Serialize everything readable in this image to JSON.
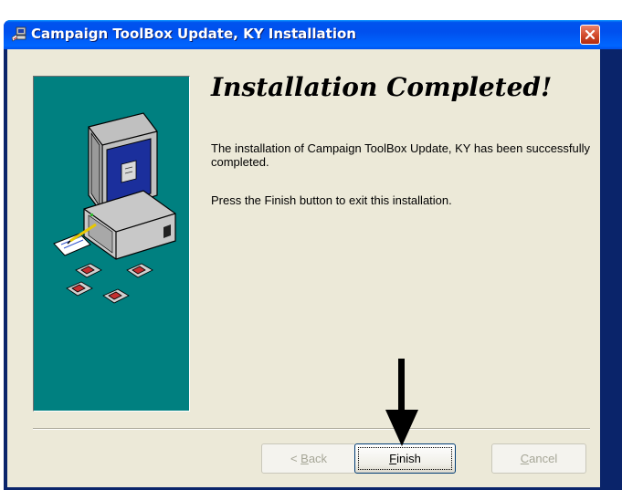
{
  "window": {
    "title": "Campaign ToolBox Update, KY Installation"
  },
  "content": {
    "heading": "Installation Completed!",
    "paragraph1": "The installation of Campaign ToolBox Update, KY has been successfully completed.",
    "paragraph2": "Press the Finish button to exit this installation."
  },
  "buttons": {
    "back": {
      "accel": "B",
      "rest": "ack",
      "prefix": "< ",
      "enabled": false
    },
    "finish": {
      "accel": "F",
      "rest": "inish",
      "enabled": true,
      "focused": true
    },
    "cancel": {
      "accel": "C",
      "rest": "ancel",
      "enabled": false
    }
  },
  "icons": {
    "app": "installer-icon",
    "close": "close-icon",
    "illustration": "computer-with-disks-illustration",
    "annotation": "down-arrow-icon"
  },
  "colors": {
    "titlebar": "#0054e3",
    "side_panel": "#008080",
    "dialog_bg": "#ece9d8",
    "close_button": "#d24b2a"
  }
}
